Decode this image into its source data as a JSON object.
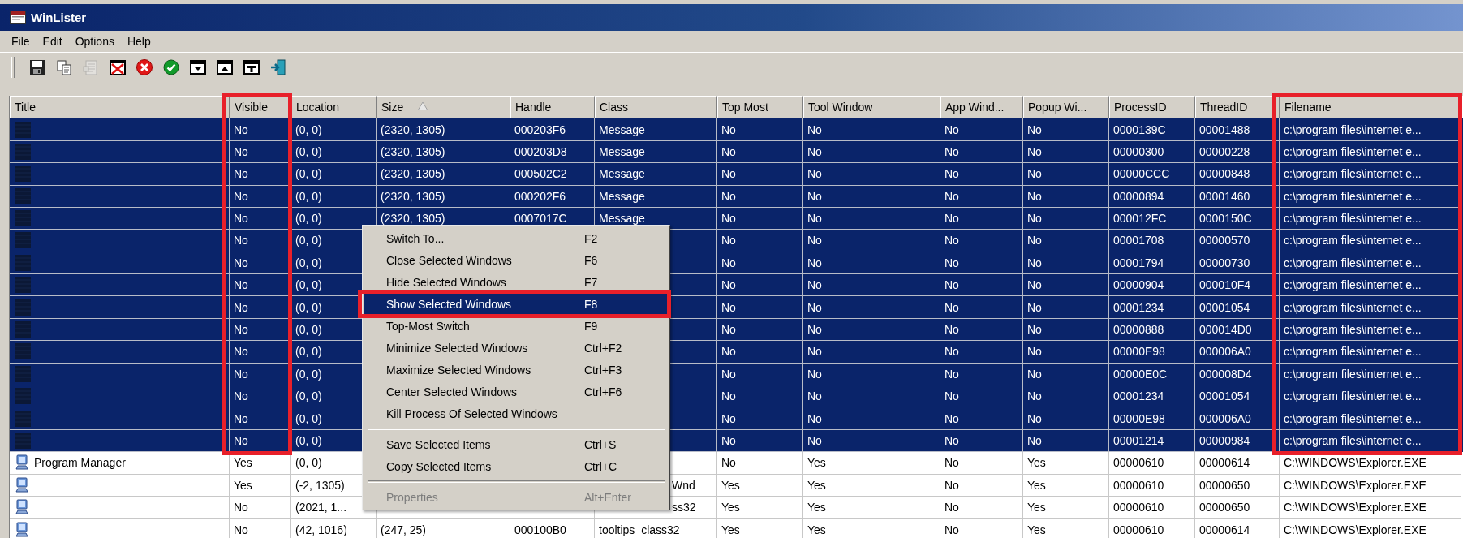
{
  "window": {
    "title": "WinLister"
  },
  "menu_bar": [
    "File",
    "Edit",
    "Options",
    "Help"
  ],
  "toolbar": [
    {
      "kind": "save",
      "disabled": false
    },
    {
      "kind": "copy",
      "disabled": false
    },
    {
      "kind": "properties",
      "disabled": true
    },
    {
      "kind": "close-window",
      "disabled": false
    },
    {
      "kind": "close",
      "disabled": false
    },
    {
      "kind": "check",
      "disabled": false
    },
    {
      "kind": "minimize-window",
      "disabled": false
    },
    {
      "kind": "maximize-window",
      "disabled": false
    },
    {
      "kind": "topmost-window",
      "disabled": false
    },
    {
      "kind": "exit",
      "disabled": false
    }
  ],
  "columns": [
    {
      "label": "Title",
      "highlighted": false
    },
    {
      "label": "Visible",
      "highlighted": true
    },
    {
      "label": "Location",
      "highlighted": false
    },
    {
      "label": "Size",
      "highlighted": false,
      "sorted": true
    },
    {
      "label": "Handle",
      "highlighted": false
    },
    {
      "label": "Class",
      "highlighted": false
    },
    {
      "label": "Top Most",
      "highlighted": false
    },
    {
      "label": "Tool Window",
      "highlighted": false
    },
    {
      "label": "App Wind...",
      "highlighted": false
    },
    {
      "label": "Popup Wi...",
      "highlighted": false
    },
    {
      "label": "ProcessID",
      "highlighted": false
    },
    {
      "label": "ThreadID",
      "highlighted": false
    },
    {
      "label": "Filename",
      "highlighted": true
    }
  ],
  "rows": [
    {
      "selected": true,
      "cells": [
        null,
        "No",
        "(0, 0)",
        "(2320, 1305)",
        "000203F6",
        "Message",
        "No",
        "No",
        "No",
        "No",
        "0000139C",
        "00001488",
        "c:\\program files\\internet e..."
      ]
    },
    {
      "selected": true,
      "cells": [
        null,
        "No",
        "(0, 0)",
        "(2320, 1305)",
        "000203D8",
        "Message",
        "No",
        "No",
        "No",
        "No",
        "00000300",
        "00000228",
        "c:\\program files\\internet e..."
      ]
    },
    {
      "selected": true,
      "cells": [
        null,
        "No",
        "(0, 0)",
        "(2320, 1305)",
        "000502C2",
        "Message",
        "No",
        "No",
        "No",
        "No",
        "00000CCC",
        "00000848",
        "c:\\program files\\internet e..."
      ]
    },
    {
      "selected": true,
      "cells": [
        null,
        "No",
        "(0, 0)",
        "(2320, 1305)",
        "000202F6",
        "Message",
        "No",
        "No",
        "No",
        "No",
        "00000894",
        "00001460",
        "c:\\program files\\internet e..."
      ]
    },
    {
      "selected": true,
      "cells": [
        null,
        "No",
        "(0, 0)",
        "(2320, 1305)",
        "0007017C",
        "Message",
        "No",
        "No",
        "No",
        "No",
        "000012FC",
        "0000150C",
        "c:\\program files\\internet e..."
      ]
    },
    {
      "selected": true,
      "cells": [
        null,
        "No",
        "(0, 0)",
        null,
        null,
        null,
        "No",
        "No",
        "No",
        "No",
        "00001708",
        "00000570",
        "c:\\program files\\internet e..."
      ]
    },
    {
      "selected": true,
      "cells": [
        null,
        "No",
        "(0, 0)",
        null,
        null,
        null,
        "No",
        "No",
        "No",
        "No",
        "00001794",
        "00000730",
        "c:\\program files\\internet e..."
      ]
    },
    {
      "selected": true,
      "cells": [
        null,
        "No",
        "(0, 0)",
        null,
        null,
        null,
        "No",
        "No",
        "No",
        "No",
        "00000904",
        "000010F4",
        "c:\\program files\\internet e..."
      ]
    },
    {
      "selected": true,
      "cells": [
        null,
        "No",
        "(0, 0)",
        null,
        null,
        null,
        "No",
        "No",
        "No",
        "No",
        "00001234",
        "00001054",
        "c:\\program files\\internet e..."
      ]
    },
    {
      "selected": true,
      "cells": [
        null,
        "No",
        "(0, 0)",
        null,
        null,
        null,
        "No",
        "No",
        "No",
        "No",
        "00000888",
        "000014D0",
        "c:\\program files\\internet e..."
      ]
    },
    {
      "selected": true,
      "cells": [
        null,
        "No",
        "(0, 0)",
        null,
        null,
        null,
        "No",
        "No",
        "No",
        "No",
        "00000E98",
        "000006A0",
        "c:\\program files\\internet e..."
      ]
    },
    {
      "selected": true,
      "cells": [
        null,
        "No",
        "(0, 0)",
        null,
        null,
        null,
        "No",
        "No",
        "No",
        "No",
        "00000E0C",
        "000008D4",
        "c:\\program files\\internet e..."
      ]
    },
    {
      "selected": true,
      "cells": [
        null,
        "No",
        "(0, 0)",
        null,
        null,
        null,
        "No",
        "No",
        "No",
        "No",
        "00001234",
        "00001054",
        "c:\\program files\\internet e..."
      ]
    },
    {
      "selected": true,
      "cells": [
        null,
        "No",
        "(0, 0)",
        null,
        null,
        null,
        "No",
        "No",
        "No",
        "No",
        "00000E98",
        "000006A0",
        "c:\\program files\\internet e..."
      ]
    },
    {
      "selected": true,
      "cells": [
        null,
        "No",
        "(0, 0)",
        null,
        null,
        null,
        "No",
        "No",
        "No",
        "No",
        "00001214",
        "00000984",
        "c:\\program files\\internet e..."
      ]
    },
    {
      "selected": false,
      "cells": [
        "Program Manager",
        "Yes",
        "(0, 0)",
        null,
        null,
        null,
        "No",
        "Yes",
        "No",
        "Yes",
        "00000610",
        "00000614",
        "C:\\WINDOWS\\Explorer.EXE"
      ]
    },
    {
      "selected": false,
      "cells": [
        null,
        "Yes",
        "(-2, 1305)",
        null,
        null,
        {
          "text": "Wnd",
          "clipped": true
        },
        "Yes",
        "Yes",
        "No",
        "Yes",
        "00000610",
        "00000650",
        "C:\\WINDOWS\\Explorer.EXE"
      ]
    },
    {
      "selected": false,
      "cells": [
        null,
        "No",
        "(2021, 1...",
        null,
        null,
        {
          "text": "ss32",
          "clipped": true
        },
        "Yes",
        "Yes",
        "No",
        "Yes",
        "00000610",
        "00000650",
        "C:\\WINDOWS\\Explorer.EXE"
      ]
    },
    {
      "selected": false,
      "cells": [
        null,
        "No",
        "(42, 1016)",
        "(247, 25)",
        "000100B0",
        "tooltips_class32",
        "Yes",
        "Yes",
        "No",
        "Yes",
        "00000610",
        "00000614",
        "C:\\WINDOWS\\Explorer.EXE"
      ]
    }
  ],
  "context_menu": [
    {
      "kind": "item",
      "label": "Switch To...",
      "shortcut": "F2",
      "selected": false,
      "disabled": false
    },
    {
      "kind": "item",
      "label": "Close Selected Windows",
      "shortcut": "F6",
      "selected": false,
      "disabled": false
    },
    {
      "kind": "item",
      "label": "Hide Selected Windows",
      "shortcut": "F7",
      "selected": false,
      "disabled": false
    },
    {
      "kind": "item",
      "label": "Show Selected Windows",
      "shortcut": "F8",
      "selected": true,
      "disabled": false,
      "highlighted": true
    },
    {
      "kind": "item",
      "label": "Top-Most Switch",
      "shortcut": "F9",
      "selected": false,
      "disabled": false
    },
    {
      "kind": "item",
      "label": "Minimize Selected Windows",
      "shortcut": "Ctrl+F2",
      "selected": false,
      "disabled": false
    },
    {
      "kind": "item",
      "label": "Maximize Selected Windows",
      "shortcut": "Ctrl+F3",
      "selected": false,
      "disabled": false
    },
    {
      "kind": "item",
      "label": "Center Selected Windows",
      "shortcut": "Ctrl+F6",
      "selected": false,
      "disabled": false
    },
    {
      "kind": "item",
      "label": "Kill Process Of Selected Windows",
      "selected": false,
      "disabled": false
    },
    {
      "kind": "separator"
    },
    {
      "kind": "item",
      "label": "Save Selected Items",
      "shortcut": "Ctrl+S",
      "selected": false,
      "disabled": false
    },
    {
      "kind": "item",
      "label": "Copy Selected Items",
      "shortcut": "Ctrl+C",
      "selected": false,
      "disabled": false
    },
    {
      "kind": "separator"
    },
    {
      "kind": "item",
      "label": "Properties",
      "shortcut": "Alt+Enter",
      "selected": false,
      "disabled": true
    }
  ]
}
